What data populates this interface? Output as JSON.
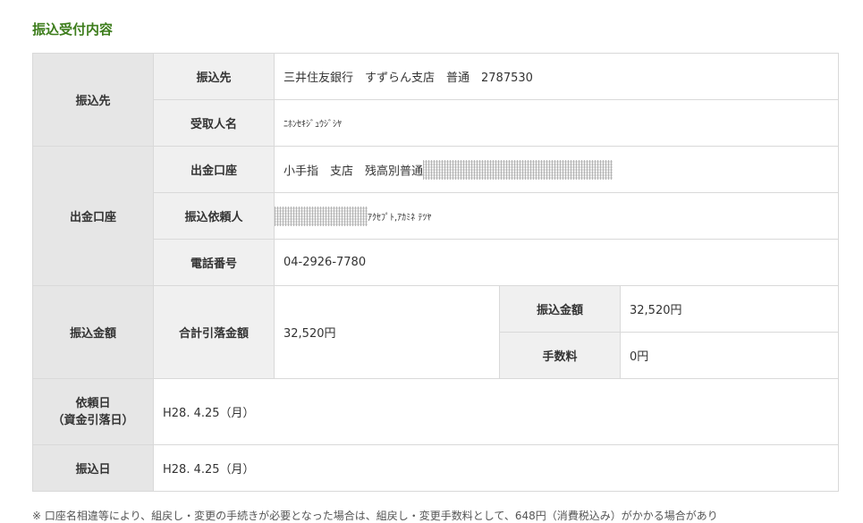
{
  "page": {
    "title": "振込受付内容",
    "footnote": "※ 口座名相違等により、組戻し・変更の手続きが必要となった場合は、組戻し・変更手数料として、648円（消費税込み）がかかる場合があり"
  },
  "receipt": {
    "payee_group": {
      "label": "振込先",
      "destination_label": "振込先",
      "destination_value": "三井住友銀行　すずらん支店　普通　2787530",
      "recipient_label": "受取人名",
      "recipient_value": "ﾆﾎﾝｾｷｼﾞｭｳｼﾞｼﾔ"
    },
    "debit_group": {
      "label": "出金口座",
      "account_label": "出金口座",
      "account_value": "小手指　支店　残高別普通",
      "requester_label": "振込依頼人",
      "requester_value": "ｱｸｾﾌﾟﾄ,ｱｶﾐﾈ ﾃﾂﾔ",
      "phone_label": "電話番号",
      "phone_value": "04-2926-7780"
    },
    "amount_group": {
      "label": "振込金額",
      "total_label": "合計引落金額",
      "total_value": "32,520円",
      "transfer_label": "振込金額",
      "transfer_value": "32,520円",
      "fee_label": "手数料",
      "fee_value": "0円"
    },
    "request_date": {
      "label_line1": "依頼日",
      "label_line2": "（資金引落日）",
      "value": "H28. 4.25（月）"
    },
    "transfer_date": {
      "label": "振込日",
      "value": "H28. 4.25（月）"
    }
  }
}
